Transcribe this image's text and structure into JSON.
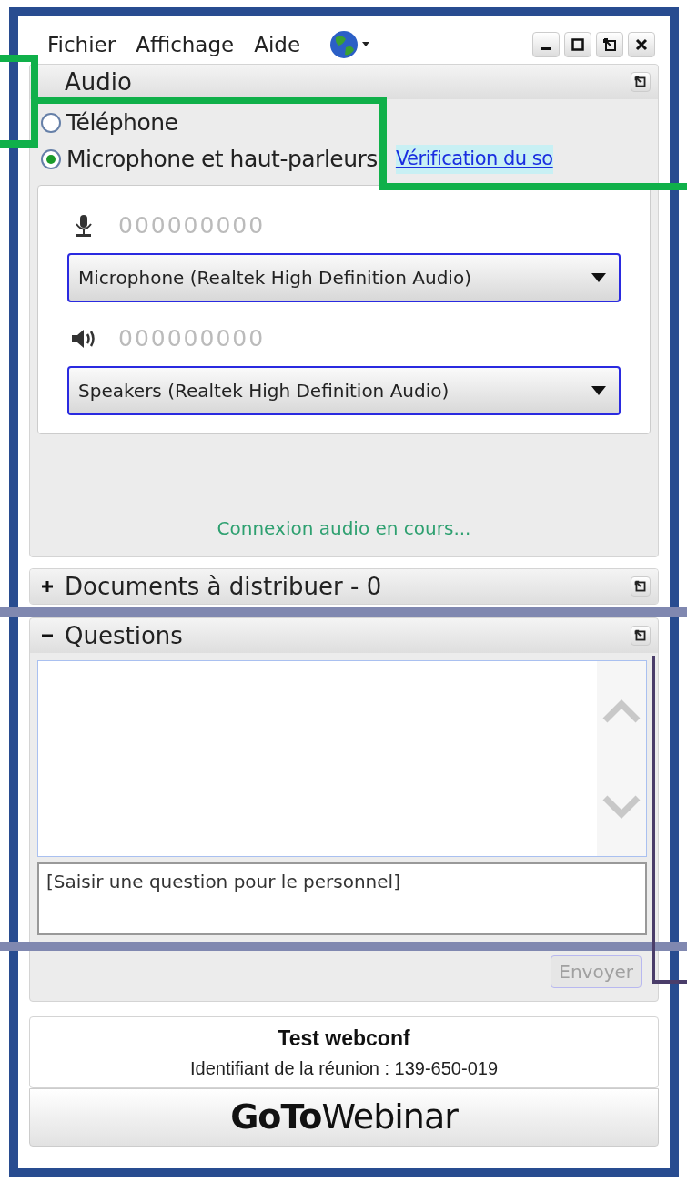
{
  "menu": [
    {
      "label": "Fichier"
    },
    {
      "label": "Affichage"
    },
    {
      "label": "Aide"
    }
  ],
  "audio": {
    "title": "Audio",
    "options": [
      {
        "label": "Téléphone",
        "selected": false
      },
      {
        "label": "Microphone et haut-parleurs",
        "selected": true
      }
    ],
    "check_link": "Vérification du so",
    "devices": [
      {
        "kind": "microphone",
        "meter": "000000000",
        "device": "Microphone (Realtek High Definition Audio)"
      },
      {
        "kind": "speaker",
        "meter": "000000000",
        "device": "Speakers (Realtek High Definition Audio)"
      }
    ],
    "status": "Connexion audio en cours..."
  },
  "documents": {
    "title": "Documents à distribuer - 0",
    "expanded": false
  },
  "questions": {
    "title": "Questions",
    "expanded": true,
    "placeholder": "[Saisir une question pour le personnel]",
    "send_button": {
      "label": "Envoyer",
      "disabled": true
    }
  },
  "info": {
    "title": "Test webconf",
    "meeting_id": "Identifiant de la réunion : 139-650-019"
  },
  "logo": "**GoTo**Webinar"
}
